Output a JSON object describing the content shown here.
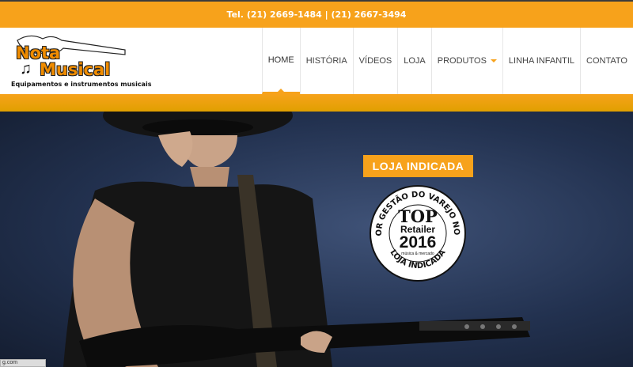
{
  "topbar": {
    "phone": "Tel. (21) 2669-1484 | (21) 2667-3494"
  },
  "logo": {
    "line1": "Nota",
    "line2": "Musical",
    "tagline": "Equipamentos e instrumentos musicais"
  },
  "nav": {
    "items": [
      {
        "label": "HOME"
      },
      {
        "label": "HISTÓRIA"
      },
      {
        "label": "VÍDEOS"
      },
      {
        "label": "LOJA"
      },
      {
        "label": "PRODUTOS"
      },
      {
        "label": "LINHA INFANTIL"
      },
      {
        "label": "CONTATO"
      }
    ],
    "active_index": 0
  },
  "hero": {
    "badge": "LOJA INDICADA",
    "seal": {
      "ring_text": "A MELHOR GESTÃO DO VAREJO NO BRASIL",
      "bottom_text": "LOJA INDICADA",
      "top": "TOP",
      "retailer": "Retailer",
      "year": "2016",
      "publisher": "música & mercado"
    }
  },
  "status_bar": {
    "text": "g.com"
  },
  "colors": {
    "accent": "#f7a21b",
    "header_bg": "#ffffff",
    "hero_bg": "#22314f"
  }
}
